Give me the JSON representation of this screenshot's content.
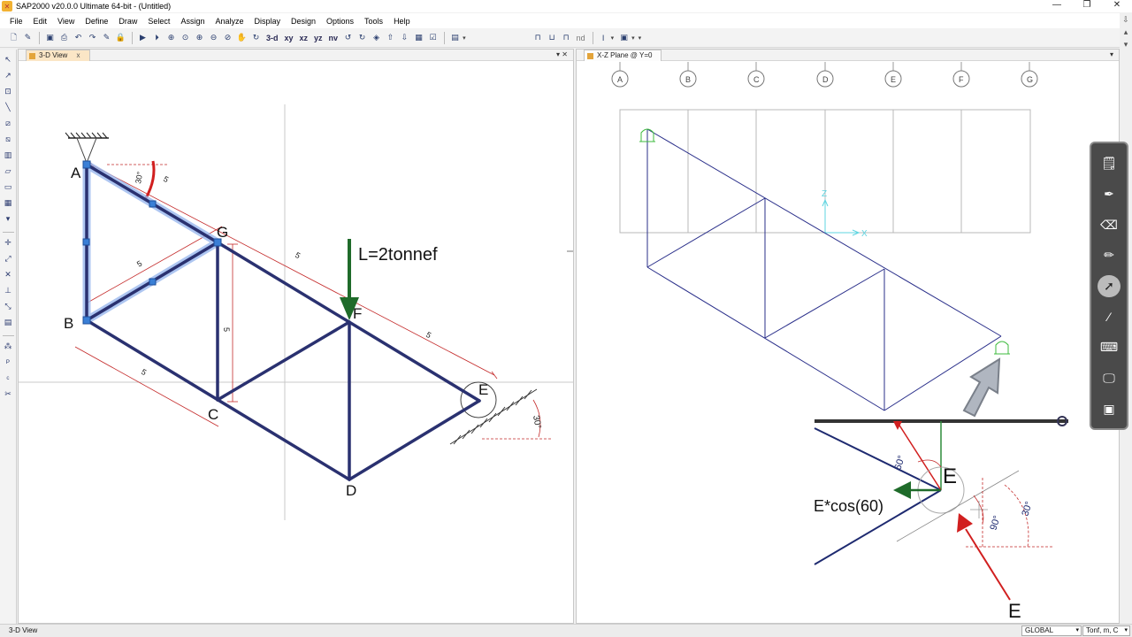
{
  "window": {
    "title": "SAP2000 v20.0.0 Ultimate 64-bit - (Untitled)",
    "controls": [
      "—",
      "❐",
      "✕"
    ]
  },
  "menu": [
    "File",
    "Edit",
    "View",
    "Define",
    "Draw",
    "Select",
    "Assign",
    "Analyze",
    "Display",
    "Design",
    "Options",
    "Tools",
    "Help"
  ],
  "toolbar": {
    "view_buttons": [
      "3-d",
      "xy",
      "xz",
      "yz",
      "nv"
    ],
    "nd_label": "nd"
  },
  "left_panel": {
    "tab_label": "3-D View",
    "close_glyph": "x",
    "controls": "▾ ✕"
  },
  "right_panel": {
    "tab_label": "X-Z Plane @ Y=0",
    "controls": "▾",
    "grid_bubbles": [
      "A",
      "B",
      "C",
      "D",
      "E",
      "F",
      "G"
    ],
    "axis_labels": {
      "z": "Z",
      "x": "X"
    }
  },
  "truss_sketch": {
    "nodes": [
      "A",
      "B",
      "C",
      "D",
      "E",
      "F",
      "G"
    ],
    "load_label": "L=2tonnef",
    "dimension_labels": [
      "5",
      "5",
      "5",
      "5",
      "5",
      "5"
    ],
    "angle_labels": [
      "30°",
      "30°"
    ]
  },
  "force_sketch": {
    "node_label": "E",
    "component_label": "E*cos(60)",
    "angle_labels": [
      "60°",
      "30°",
      "90°"
    ],
    "reaction_label": "E"
  },
  "status": {
    "left_text": "3-D View",
    "coord_system": "GLOBAL",
    "units": "Tonf, m, C"
  },
  "colors": {
    "truss": "#2a3170",
    "highlight": "#8fb0e8",
    "load_arrow": "#1f6b2a",
    "reaction": "#d11f1f",
    "grid": "#b8b8b8",
    "model_line": "#2a2f8a",
    "support": "#3dbb3d"
  }
}
